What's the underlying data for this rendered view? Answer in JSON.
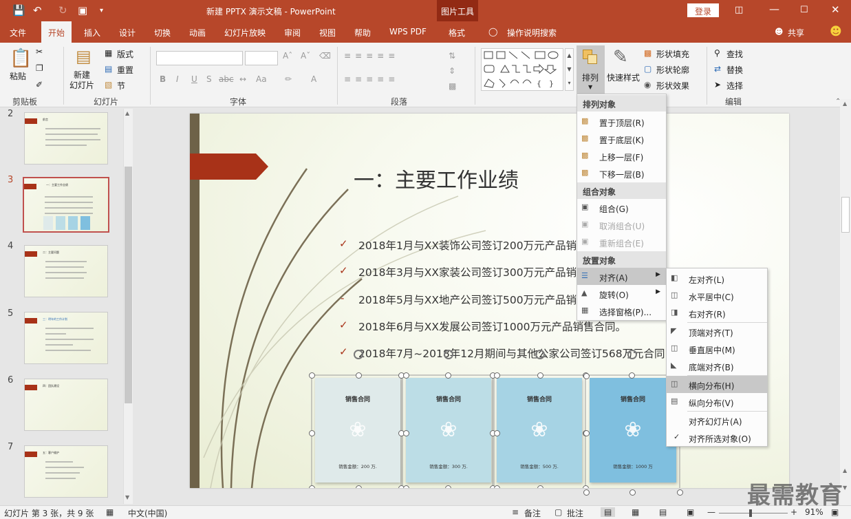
{
  "window": {
    "title": "新建 PPTX 演示文稿 - PowerPoint",
    "context_tab": "图片工具",
    "login": "登录"
  },
  "tabs": [
    "文件",
    "开始",
    "插入",
    "设计",
    "切换",
    "动画",
    "幻灯片放映",
    "审阅",
    "视图",
    "帮助",
    "WPS PDF",
    "格式"
  ],
  "tell_me": "操作说明搜索",
  "share": "共享",
  "ribbon": {
    "clipboard": {
      "paste": "粘贴",
      "label": "剪贴板"
    },
    "slides": {
      "new_slide": "新建\n幻灯片",
      "layout": "版式",
      "reset": "重置",
      "section": "节",
      "label": "幻灯片"
    },
    "font": {
      "label": "字体"
    },
    "paragraph": {
      "label": "段落"
    },
    "drawing": {
      "arrange": "排列",
      "quick_styles": "快速样式",
      "shape_fill": "形状填充",
      "shape_outline": "形状轮廓",
      "shape_effects": "形状效果"
    },
    "editing": {
      "find": "查找",
      "replace": "替换",
      "select": "选择",
      "label": "编辑"
    }
  },
  "thumbnails": [
    {
      "num": "2",
      "title": "前言"
    },
    {
      "num": "3",
      "title": "一：主要工作业绩"
    },
    {
      "num": "4",
      "title": "二：主要问题"
    },
    {
      "num": "5",
      "title": "三：明年的工作计划"
    },
    {
      "num": "6",
      "title": "四：团队建设"
    },
    {
      "num": "7",
      "title": "五：客户维护"
    }
  ],
  "slide": {
    "title": "一：主要工作业绩",
    "bullets": [
      {
        "mark": "✓",
        "text": "2018年1月与XX装饰公司签订200万元产品销"
      },
      {
        "mark": "✓",
        "text": "2018年3月与XX家装公司签订300万元产品销"
      },
      {
        "mark": "-",
        "text": "2018年5月与XX地产公司签订500万元产品销"
      },
      {
        "mark": "✓",
        "text": "2018年6月与XX发展公司签订1000万元产品销售合同。"
      },
      {
        "mark": "✓",
        "text": "2018年7月~2018年12月期间与其他公家公司签订568万元合同"
      }
    ],
    "cards": [
      {
        "title": "销售合同",
        "amount": "销售金额：200 万.",
        "color": "#dfeaea"
      },
      {
        "title": "销售合同",
        "amount": "销售金额：300 万.",
        "color": "#bcdde6"
      },
      {
        "title": "销售合同",
        "amount": "销售金额：500 万.",
        "color": "#a6d3e4"
      },
      {
        "title": "销售合同",
        "amount": "销售金额：1000 万",
        "color": "#7fbfdf"
      }
    ]
  },
  "arrange_menu": {
    "h1": "排列对象",
    "to_front": "置于顶层(R)",
    "to_back": "置于底层(K)",
    "forward": "上移一层(F)",
    "backward": "下移一层(B)",
    "h2": "组合对象",
    "group": "组合(G)",
    "ungroup": "取消组合(U)",
    "regroup": "重新组合(E)",
    "h3": "放置对象",
    "align": "对齐(A)",
    "rotate": "旋转(O)",
    "selection_pane": "选择窗格(P)..."
  },
  "align_menu": {
    "left": "左对齐(L)",
    "center": "水平居中(C)",
    "right": "右对齐(R)",
    "top": "顶端对齐(T)",
    "middle": "垂直居中(M)",
    "bottom": "底端对齐(B)",
    "dist_h": "横向分布(H)",
    "dist_v": "纵向分布(V)",
    "to_slide": "对齐幻灯片(A)",
    "to_selected": "对齐所选对象(O)",
    "checked": "✓"
  },
  "status": {
    "slide_info": "幻灯片 第 3 张，共 9 张",
    "lang": "中文(中国)",
    "notes": "备注",
    "comments": "批注",
    "zoom": "91%"
  },
  "watermark": "最需教育"
}
